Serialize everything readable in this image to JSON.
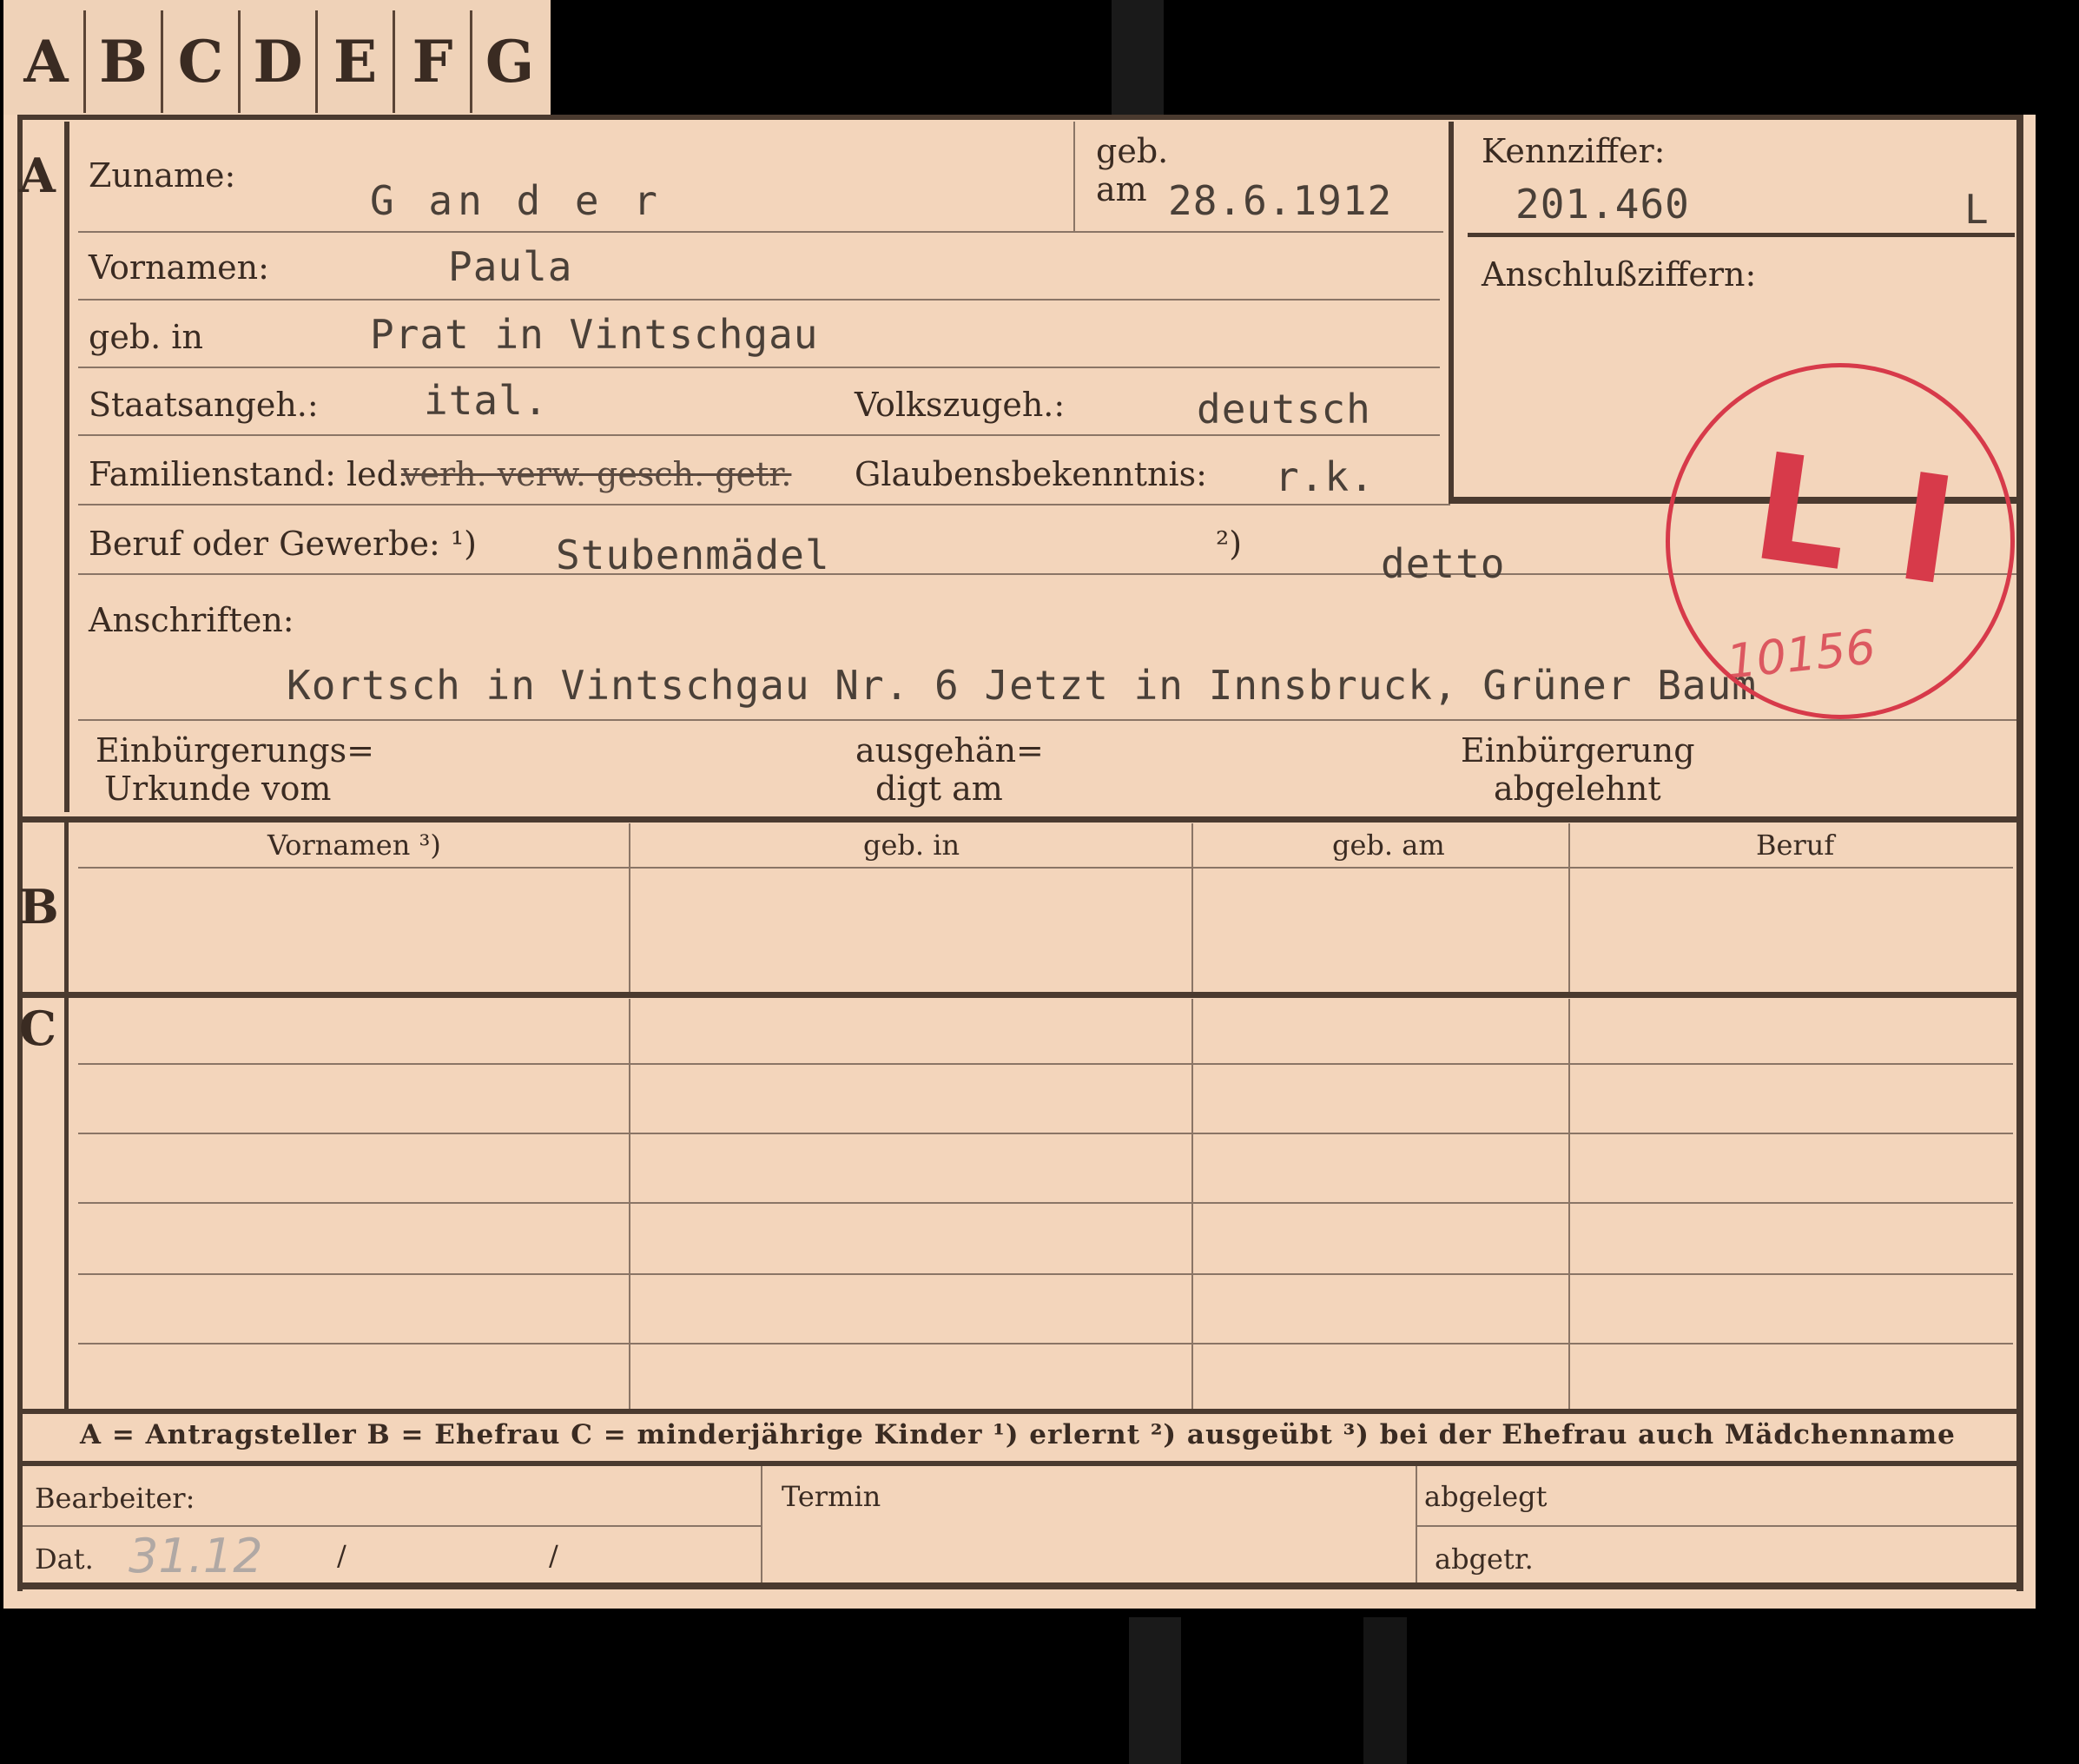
{
  "tabs": [
    "A",
    "B",
    "C",
    "D",
    "E",
    "F",
    "G"
  ],
  "section_letters": {
    "a": "A",
    "b": "B",
    "c": "C"
  },
  "labels": {
    "zuname": "Zuname:",
    "geb_top": "geb.",
    "geb_am": "am",
    "kennziffer": "Kennziffer:",
    "anschlussziffern": "Anschlußziffern:",
    "vornamen": "Vornamen:",
    "geb_in": "geb. in",
    "staatsangeh": "Staatsangeh.:",
    "volkszugeh": "Volkszugeh.:",
    "familienstand": "Familienstand: led.",
    "familienstand_struck": "verh. verw. gesch. getr.",
    "glaubensbekenntnis": "Glaubensbekenntnis:",
    "beruf": "Beruf oder Gewerbe: ¹)",
    "beruf_2": "²)",
    "anschriften": "Anschriften:",
    "einbuergerung_1": "Einbürgerungs=",
    "einbuergerung_2": "Urkunde vom",
    "ausgehaen_1": "ausgehän=",
    "ausgehaen_2": "digt am",
    "abgelehnt_1": "Einbürgerung",
    "abgelehnt_2": "abgelehnt"
  },
  "values": {
    "zuname": "G an d e r",
    "geb_am": "28.6.1912",
    "kennziffer": "201.460",
    "kennziffer_suffix": "L",
    "vornamen": "Paula",
    "geb_in": "Prat in Vintschgau",
    "staatsangeh": "ital.",
    "volkszugeh": "deutsch",
    "glaubensbekenntnis": "r.k.",
    "beruf_1": "Stubenmädel",
    "beruf_2": "detto",
    "anschriften": "Kortsch in Vintschgau Nr. 6 Jetzt in Innsbruck, Grüner Baum"
  },
  "stamp": {
    "text": "L I",
    "number": "10156",
    "color": "#d73a4a"
  },
  "table_b_headers": [
    "Vornamen ³)",
    "geb. in",
    "geb. am",
    "Beruf"
  ],
  "legend": "A = Antragsteller   B = Ehefrau   C = minderjährige Kinder   ¹) erlernt   ²) ausgeübt   ³) bei der Ehefrau auch Mädchenname",
  "footer": {
    "bearbeiter": "Bearbeiter:",
    "termin": "Termin",
    "abgelegt": "abgelegt",
    "dat": "Dat.",
    "dat_slash1": "/",
    "dat_slash2": "/",
    "abgetr": "abgetr.",
    "pencil_date": "31.12"
  }
}
